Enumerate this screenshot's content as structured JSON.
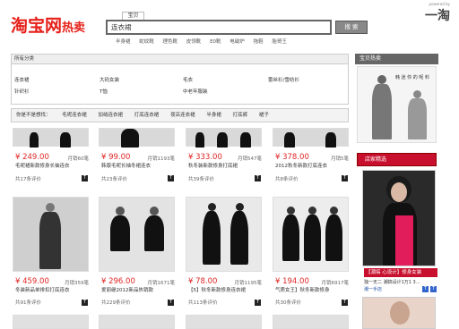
{
  "header": {
    "logo_main": "淘宝网",
    "logo_sub": "热卖",
    "search_tab": "宝贝",
    "search_value": "连衣裙",
    "search_button": "搜 索",
    "hot_words": [
      "半身裙",
      "蛇纹靴",
      "理色靴",
      "皮领靴",
      "E0靴",
      "电磁炉",
      "拖鞋",
      "胎哥王"
    ],
    "powered_by": "powered by",
    "brand": "一淘"
  },
  "categories": {
    "title": "所有分类",
    "items": [
      "连衣裙",
      "大码女装",
      "毛衣",
      "蕾丝衫/雪纺衫",
      "针织衫",
      "T恤",
      "中老年服装"
    ]
  },
  "guess": {
    "label": "你是不是想找：",
    "items": [
      "毛呢连衣裙",
      "加绒连衣裙",
      "打底连衣裙",
      "夜店连衣裙",
      "半身裙",
      "打底裤",
      "裙子"
    ]
  },
  "products_row1": [
    {
      "price": "¥ 249.00",
      "sold": "月销60笔",
      "title": "毛呢裙新款修身长袖连衣",
      "reviews": "共17条评价"
    },
    {
      "price": "¥ 99.00",
      "sold": "月销1193笔",
      "title": "韩版毛呢长袖冬裙连衣",
      "reviews": "共23条评价"
    },
    {
      "price": "¥ 333.00",
      "sold": "月销547笔",
      "title": "秋冬装新款修身打底裙",
      "reviews": "共39条评价"
    },
    {
      "price": "¥ 378.00",
      "sold": "月销5笔",
      "title": "2012秋冬新款打底连衣",
      "reviews": "共8条评价"
    }
  ],
  "products_row2": [
    {
      "price": "¥ 459.00",
      "sold": "月销359笔",
      "title": "冬装新品单排扣打底连衣",
      "reviews": "共91条评价"
    },
    {
      "price": "¥ 296.00",
      "sold": "月销1671笔",
      "title": "爱丽缇2012新品热销款",
      "reviews": "共229条评价"
    },
    {
      "price": "¥ 78.00",
      "sold": "月销1195笔",
      "title": "【5】秋冬新款修身连衣裙",
      "reviews": "共113条评价"
    },
    {
      "price": "¥ 194.00",
      "sold": "月销6917笔",
      "title": "气质女王】秋冬新款修身",
      "reviews": "共30条评价"
    }
  ],
  "sidebar": {
    "title": "宝贝热卖",
    "ad_text": "韩 迷 你 的 呢 料",
    "shop_title": "店家精选",
    "promo_text": "【潮搞 心设计】修身女装",
    "promo_sub": "独一无二 潮搞设计1万1 3…",
    "promo_link": "潮一手店"
  },
  "colors": {
    "accent_red": "#e62019",
    "shop_header": "#c8102e"
  }
}
